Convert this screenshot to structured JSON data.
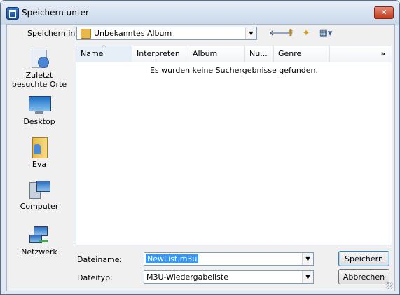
{
  "window": {
    "title": "Speichern unter",
    "close_label": "✕"
  },
  "location": {
    "label": "Speichern in:",
    "value": "Unbekanntes Album"
  },
  "toolbar": {
    "back_glyph": "🡐",
    "up_glyph": "⬆",
    "new_folder_glyph": "✦",
    "views_glyph": "▦▾"
  },
  "places": [
    {
      "label": "Zuletzt besuchte Orte",
      "icon": "recent-places-icon"
    },
    {
      "label": "Desktop",
      "icon": "desktop-icon"
    },
    {
      "label": "Eva",
      "icon": "user-folder-icon"
    },
    {
      "label": "Computer",
      "icon": "computer-icon"
    },
    {
      "label": "Netzwerk",
      "icon": "network-icon"
    }
  ],
  "columns": [
    "Name",
    "Interpreten",
    "Album",
    "Nu...",
    "Genre"
  ],
  "columns_more": "»",
  "empty_message": "Es wurden keine Suchergebnisse gefunden.",
  "filename": {
    "label": "Dateiname:",
    "value": "NewList.m3u"
  },
  "filetype": {
    "label": "Dateityp:",
    "value": "M3U-Wiedergabeliste"
  },
  "buttons": {
    "save": "Speichern",
    "cancel": "Abbrechen"
  }
}
